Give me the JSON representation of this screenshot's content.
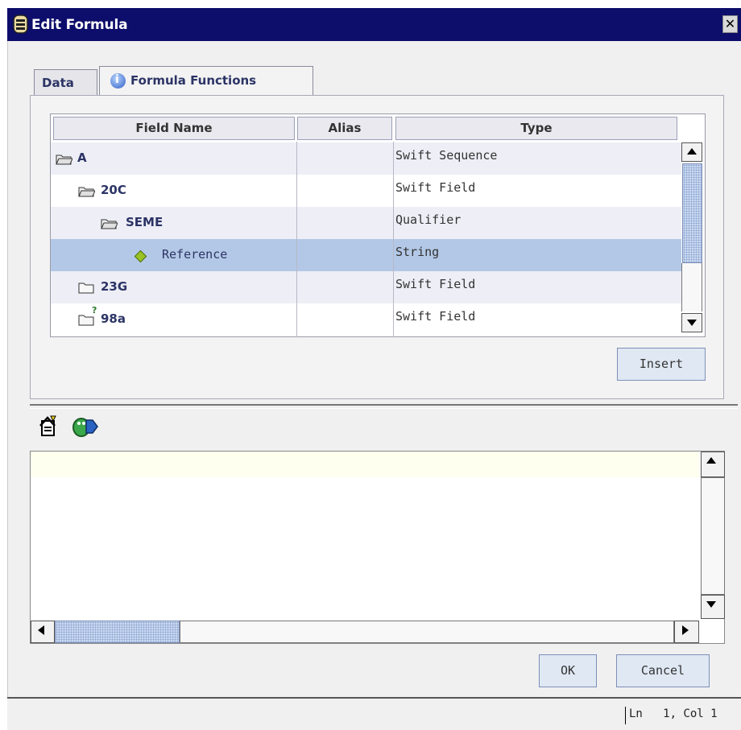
{
  "window": {
    "title": "Edit Formula",
    "close_glyph": "✕"
  },
  "tabs": [
    {
      "label": "Data",
      "icon": null
    },
    {
      "label": "Formula Functions",
      "icon": "info-icon"
    }
  ],
  "table": {
    "columns": [
      "Field Name",
      "Alias",
      "Type"
    ],
    "rows": [
      {
        "name": "A",
        "alias": "",
        "type": "Swift Sequence",
        "icon": "open-folder-icon",
        "level": 0
      },
      {
        "name": "20C",
        "alias": "",
        "type": "Swift Field",
        "icon": "open-folder-icon",
        "level": 1
      },
      {
        "name": "SEME",
        "alias": "",
        "type": "Qualifier",
        "icon": "open-folder-icon",
        "level": 2
      },
      {
        "name": "Reference",
        "alias": "",
        "type": "String",
        "icon": "diamond-icon",
        "level": 3,
        "selected": true
      },
      {
        "name": "23G",
        "alias": "",
        "type": "Swift Field",
        "icon": "closed-folder-icon",
        "level": 1
      },
      {
        "name": "98a",
        "alias": "",
        "type": "Swift Field",
        "icon": "optional-folder-icon",
        "level": 1,
        "badge": "?"
      }
    ]
  },
  "buttons": {
    "insert": "Insert",
    "ok": "OK",
    "cancel": "Cancel"
  },
  "toolbar": {
    "icons": [
      "format-icon",
      "debug-icon"
    ]
  },
  "editor": {
    "value": ""
  },
  "status": {
    "position": "Ln   1, Col 1"
  },
  "colors": {
    "titlebar": "#0d0d6b",
    "selection": "#b3c8e6",
    "tab_text": "#2c3466"
  }
}
